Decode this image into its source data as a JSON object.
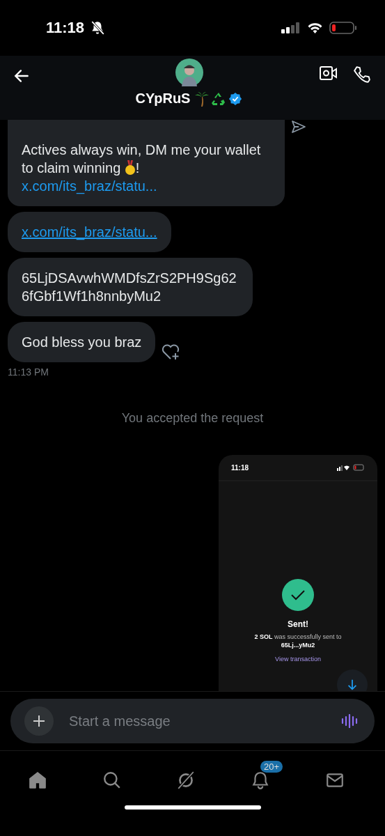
{
  "status_bar": {
    "time": "11:18"
  },
  "header": {
    "name": "CYpRuS"
  },
  "messages": [
    {
      "kind": "text_link",
      "text": "Actives always win, DM me your wallet to claim winning",
      "after_icon": "!",
      "link": "x.com/its_braz/statu..."
    },
    {
      "kind": "link",
      "link": "x.com/its_braz/statu..."
    },
    {
      "kind": "text",
      "text": "65LjDSAvwhWMDfsZrS2PH9Sg626fGbf1Wf1h8nnbyMu2"
    },
    {
      "kind": "text",
      "text": "God bless you braz",
      "react_button": true
    }
  ],
  "timestamp": "11:13 PM",
  "system_message": "You accepted the request",
  "attachment": {
    "time": "11:18",
    "title": "Sent!",
    "body": "**2 SOL** was successfully sent to",
    "address": "65Lj...yMu2",
    "link": "View transaction"
  },
  "composer": {
    "placeholder": "Start a message"
  },
  "nav": [
    {
      "kind": "home"
    },
    {
      "kind": "search"
    },
    {
      "kind": "grok"
    },
    {
      "kind": "bell",
      "badge": "20+"
    },
    {
      "kind": "mail"
    }
  ]
}
